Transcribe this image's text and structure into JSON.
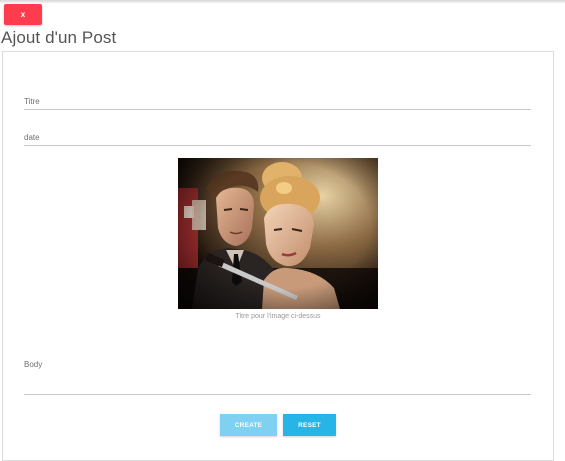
{
  "header": {
    "close_label": "x",
    "page_title": "Ajout d'un Post"
  },
  "form": {
    "titre_placeholder": "Titre",
    "date_placeholder": "date",
    "image_caption": "Titre pour l'image ci-dessus",
    "body_placeholder": "Body",
    "create_label": "CREATE",
    "reset_label": "RESET"
  },
  "colors": {
    "close_button": "#ff3c4d",
    "create_button": "#7fd0f1",
    "reset_button": "#27b4e6"
  },
  "icons": {
    "close": "close-icon"
  }
}
